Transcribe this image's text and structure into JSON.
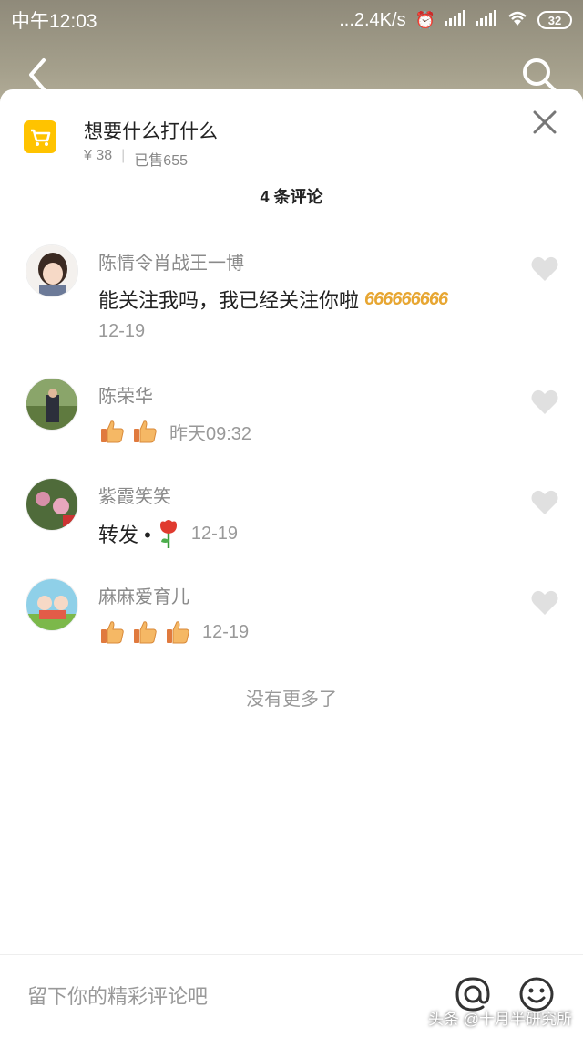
{
  "status_bar": {
    "time": "中午12:03",
    "network_speed": "...2.4K/s",
    "battery": "32"
  },
  "product": {
    "title": "想要什么打什么",
    "price": "¥ 38",
    "sold": "已售655"
  },
  "comments_header": "4 条评论",
  "comments": [
    {
      "name": "陈情令肖战王一博",
      "text": "能关注我吗，我已经关注你啦",
      "emoji_text": "666666666",
      "date": "12-19"
    },
    {
      "name": "陈荣华",
      "thumbs": 2,
      "date": "昨天09:32"
    },
    {
      "name": "紫霞笑笑",
      "text": "转发 •",
      "date": "12-19"
    },
    {
      "name": "麻麻爱育儿",
      "thumbs": 3,
      "date": "12-19"
    }
  ],
  "no_more": "没有更多了",
  "footer": {
    "placeholder": "留下你的精彩评论吧"
  },
  "watermark": "头条 @十月半研究所",
  "colors": {
    "cart": "#ffc300",
    "heart": "#e0e0e0",
    "thumb": "#f5b865"
  }
}
